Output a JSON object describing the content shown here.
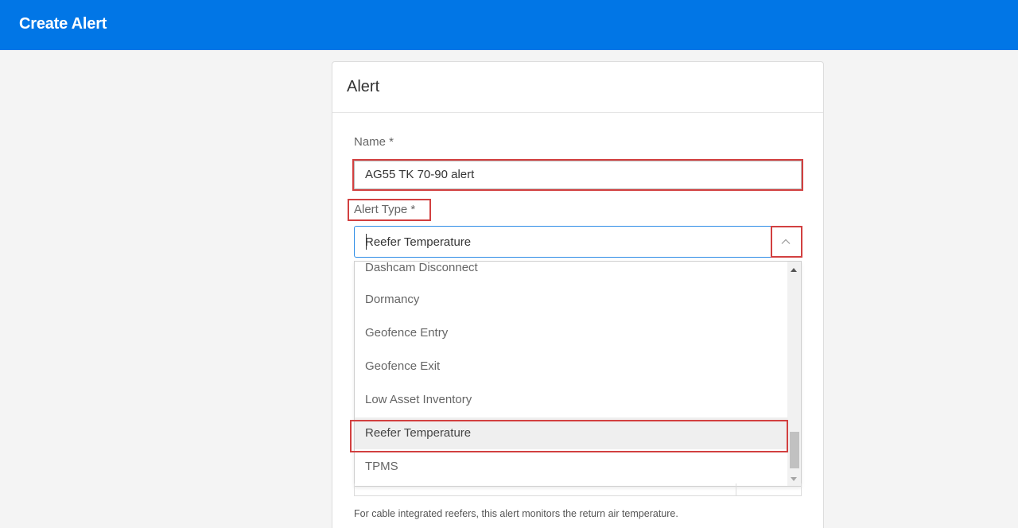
{
  "header": {
    "title": "Create Alert"
  },
  "card": {
    "title": "Alert"
  },
  "form": {
    "name_label": "Name *",
    "name_value": "AG55 TK 70-90 alert",
    "alert_type_label": "Alert Type *",
    "alert_type_value": "Reefer Temperature",
    "alert_type_options": [
      "Dashcam Disconnect",
      "Dormancy",
      "Geofence Entry",
      "Geofence Exit",
      "Low Asset Inventory",
      "Reefer Temperature",
      "TPMS"
    ],
    "selected_option": "Reefer Temperature",
    "help_text": "For cable integrated reefers, this alert monitors the return air temperature."
  },
  "icons": {
    "dropdown_toggle": "chevron-up-icon"
  },
  "colors": {
    "header_bg": "#0176e6",
    "highlight": "#d24040",
    "focus_border": "#2e8de6"
  }
}
